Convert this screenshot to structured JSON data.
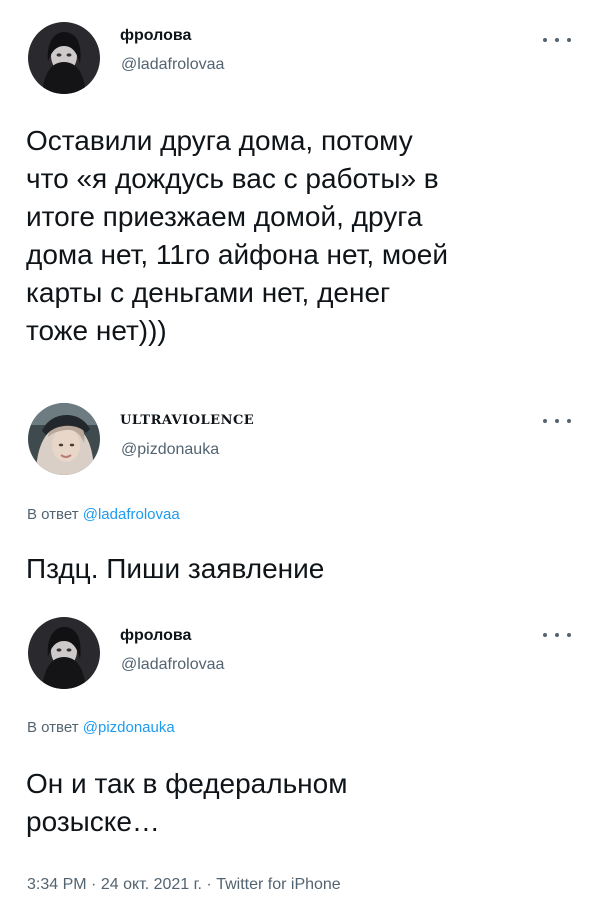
{
  "tweets": [
    {
      "display_name": "фролова",
      "handle": "@ladafrolovaa",
      "text": "Оставили друга дома, потому\nчто «я дождусь вас с работы» в\nитоге приезжаем домой, друга\nдома нет, 11го айфона нет, моей\nкарты с деньгами нет, денег\nтоже нет)))"
    },
    {
      "display_name": "ULTRAVIOLENCE",
      "handle": "@pizdonauka",
      "reply_prefix": "В ответ",
      "reply_to": "@ladafrolovaa",
      "text": "Пздц. Пиши заявление"
    },
    {
      "display_name": "фролова",
      "handle": "@ladafrolovaa",
      "reply_prefix": "В ответ",
      "reply_to": "@pizdonauka",
      "text": "Он и так в федеральном\nрозыске…"
    }
  ],
  "footer": {
    "time": "3:34 PM",
    "date": "24 окт. 2021 г.",
    "separator": "·",
    "source": "Twitter for iPhone"
  },
  "icons": {
    "more": "more-options-icon",
    "avatar": "avatar"
  },
  "colors": {
    "text_primary": "#0f1419",
    "text_secondary": "#536471",
    "link": "#1d9bf0"
  }
}
